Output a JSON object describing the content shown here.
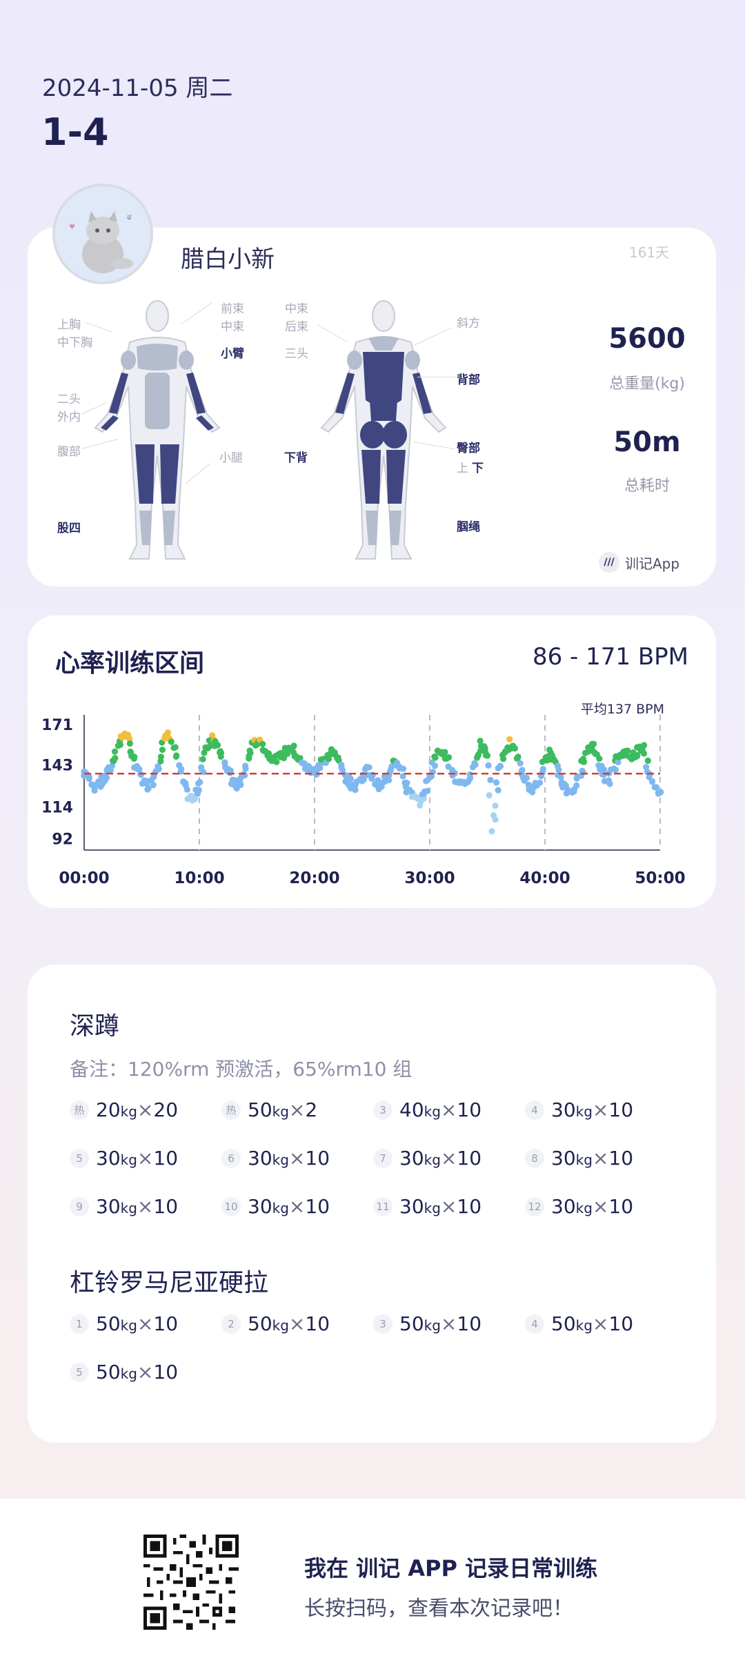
{
  "header": {
    "date": "2024-11-05 周二",
    "title": "1-4"
  },
  "profile": {
    "nickname": "腊白小新",
    "days": "161天"
  },
  "muscles": {
    "front_left": [
      "上胸",
      "中下胸",
      "二头",
      "外内",
      "腹部",
      "股四"
    ],
    "front_right": [
      "前束",
      "中束",
      "小臂",
      "小腿"
    ],
    "back_left": [
      "中束",
      "后束",
      "三头",
      "下背"
    ],
    "back_right": [
      "斜方",
      "背部",
      "臀部",
      "上",
      "下",
      "腘绳"
    ]
  },
  "stats": {
    "weight_value": "5600",
    "weight_label": "总重量(kg)",
    "time_value": "50m",
    "time_label": "总耗时"
  },
  "brand": {
    "name": "训记App"
  },
  "heart": {
    "title": "心率训练区间",
    "range": "86 - 171 BPM",
    "avg_label": "平均137 BPM"
  },
  "chart_data": {
    "type": "scatter",
    "title": "心率训练区间",
    "y_ticks": [
      "171",
      "143",
      "114",
      "92"
    ],
    "x_ticks": [
      "00:00",
      "10:00",
      "20:00",
      "30:00",
      "40:00",
      "50:00"
    ],
    "ylim": [
      86,
      171
    ],
    "xlim": [
      0,
      50
    ],
    "average": 137,
    "colors": {
      "low": "#a8d3f0",
      "mid": "#7fb8ef",
      "high": "#3dbb5e",
      "peak": "#f3bd3c",
      "avg_line": "#d93a3a"
    },
    "series": [
      {
        "values_by_minute": [
          [
            0,
            138
          ],
          [
            0.5,
            133
          ],
          [
            1,
            128
          ],
          [
            1.5,
            131
          ],
          [
            2,
            135
          ],
          [
            2.5,
            145
          ],
          [
            3,
            158
          ],
          [
            3.5,
            165
          ],
          [
            4,
            155
          ],
          [
            4.5,
            142
          ],
          [
            5,
            135
          ],
          [
            5.5,
            128
          ],
          [
            6,
            132
          ],
          [
            6.5,
            145
          ],
          [
            7,
            160
          ],
          [
            7.5,
            164
          ],
          [
            8,
            150
          ],
          [
            8.5,
            132
          ],
          [
            9,
            122
          ],
          [
            9.5,
            118
          ],
          [
            10,
            130
          ],
          [
            10.5,
            150
          ],
          [
            11,
            163
          ],
          [
            11.5,
            158
          ],
          [
            12,
            150
          ],
          [
            12.5,
            138
          ],
          [
            13,
            130
          ],
          [
            13.5,
            128
          ],
          [
            14,
            140
          ],
          [
            14.5,
            155
          ],
          [
            15,
            160
          ],
          [
            15.5,
            156
          ],
          [
            16,
            150
          ],
          [
            16.5,
            148
          ],
          [
            17,
            148
          ],
          [
            17.5,
            152
          ],
          [
            18,
            156
          ],
          [
            18.5,
            150
          ],
          [
            19,
            143
          ],
          [
            19.5,
            140
          ],
          [
            20,
            138
          ],
          [
            20.5,
            143
          ],
          [
            21,
            148
          ],
          [
            21.5,
            152
          ],
          [
            22,
            150
          ],
          [
            22.5,
            138
          ],
          [
            23,
            132
          ],
          [
            23.5,
            128
          ],
          [
            24,
            133
          ],
          [
            24.5,
            140
          ],
          [
            25,
            135
          ],
          [
            25.5,
            128
          ],
          [
            26,
            130
          ],
          [
            26.5,
            138
          ],
          [
            27,
            148
          ],
          [
            27.5,
            140
          ],
          [
            28,
            128
          ],
          [
            28.5,
            120
          ],
          [
            29,
            118
          ],
          [
            29.5,
            122
          ],
          [
            30,
            135
          ],
          [
            30.5,
            148
          ],
          [
            31,
            154
          ],
          [
            31.5,
            148
          ],
          [
            32,
            138
          ],
          [
            32.5,
            130
          ],
          [
            33,
            128
          ],
          [
            33.5,
            135
          ],
          [
            34,
            148
          ],
          [
            34.5,
            158
          ],
          [
            35,
            150
          ],
          [
            35.5,
            100
          ],
          [
            36,
            140
          ],
          [
            36.5,
            152
          ],
          [
            37,
            158
          ],
          [
            37.5,
            150
          ],
          [
            38,
            138
          ],
          [
            38.5,
            130
          ],
          [
            39,
            125
          ],
          [
            39.5,
            133
          ],
          [
            40,
            145
          ],
          [
            40.5,
            152
          ],
          [
            41,
            140
          ],
          [
            41.5,
            130
          ],
          [
            42,
            125
          ],
          [
            42.5,
            128
          ],
          [
            43,
            136
          ],
          [
            43.5,
            148
          ],
          [
            44,
            156
          ],
          [
            44.5,
            150
          ],
          [
            45,
            138
          ],
          [
            45.5,
            132
          ],
          [
            46,
            142
          ],
          [
            46.5,
            150
          ],
          [
            47,
            152
          ],
          [
            47.5,
            148
          ],
          [
            48,
            152
          ],
          [
            48.5,
            158
          ],
          [
            49,
            140
          ],
          [
            49.5,
            126
          ],
          [
            50,
            124
          ]
        ]
      }
    ]
  },
  "exercises": [
    {
      "name": "深蹲",
      "note": "备注：120%rm 预激活，65%rm10 组",
      "sets": [
        {
          "idx": "热",
          "w": "20",
          "r": "20"
        },
        {
          "idx": "热",
          "w": "50",
          "r": "2"
        },
        {
          "idx": "3",
          "w": "40",
          "r": "10"
        },
        {
          "idx": "4",
          "w": "30",
          "r": "10"
        },
        {
          "idx": "5",
          "w": "30",
          "r": "10"
        },
        {
          "idx": "6",
          "w": "30",
          "r": "10"
        },
        {
          "idx": "7",
          "w": "30",
          "r": "10"
        },
        {
          "idx": "8",
          "w": "30",
          "r": "10"
        },
        {
          "idx": "9",
          "w": "30",
          "r": "10"
        },
        {
          "idx": "10",
          "w": "30",
          "r": "10"
        },
        {
          "idx": "11",
          "w": "30",
          "r": "10"
        },
        {
          "idx": "12",
          "w": "30",
          "r": "10"
        }
      ]
    },
    {
      "name": "杠铃罗马尼亚硬拉",
      "sets": [
        {
          "idx": "1",
          "w": "50",
          "r": "10"
        },
        {
          "idx": "2",
          "w": "50",
          "r": "10"
        },
        {
          "idx": "3",
          "w": "50",
          "r": "10"
        },
        {
          "idx": "4",
          "w": "50",
          "r": "10"
        },
        {
          "idx": "5",
          "w": "50",
          "r": "10"
        }
      ]
    }
  ],
  "units": {
    "kg": "kg",
    "times": "×"
  },
  "footer": {
    "line1": "我在 训记 APP 记录日常训练",
    "line2": "长按扫码，查看本次记录吧！"
  }
}
